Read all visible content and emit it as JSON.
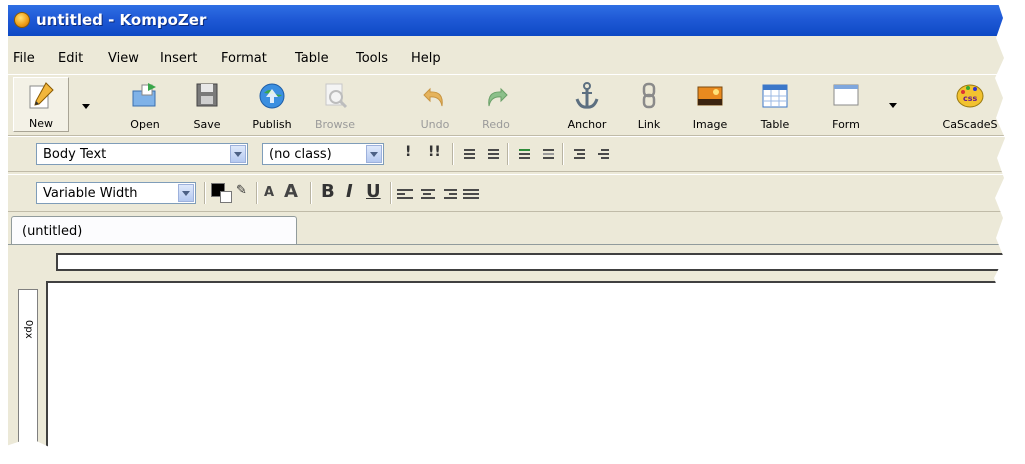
{
  "window": {
    "title": "untitled - KompoZer"
  },
  "menu": [
    "File",
    "Edit",
    "View",
    "Insert",
    "Format",
    "Table",
    "Tools",
    "Help"
  ],
  "toolbar": {
    "new": "New",
    "open": "Open",
    "save": "Save",
    "publish": "Publish",
    "browse": "Browse",
    "undo": "Undo",
    "redo": "Redo",
    "anchor": "Anchor",
    "link": "Link",
    "image": "Image",
    "table": "Table",
    "form": "Form",
    "cascades": "CaScadeS"
  },
  "format": {
    "paragraph_style": "Body Text",
    "class_style": "(no class)",
    "font": "Variable Width",
    "text_color": "#000000",
    "bold": "B",
    "italic": "I",
    "underline": "U",
    "smaller": "A",
    "larger": "A"
  },
  "tabs": [
    "(untitled)"
  ],
  "vruler": {
    "unit": "0px"
  }
}
